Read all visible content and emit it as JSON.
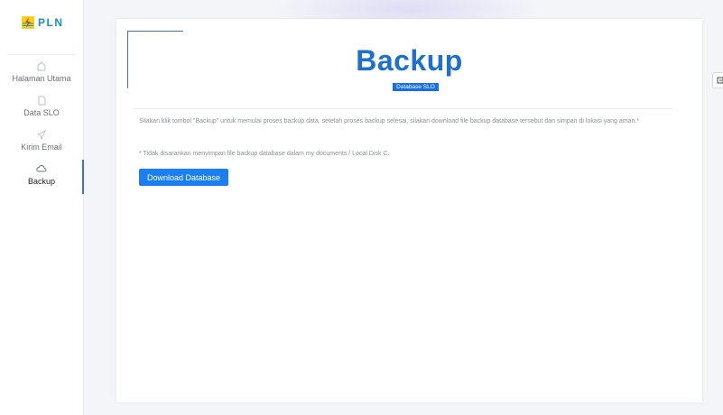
{
  "brand": {
    "name": "PLN"
  },
  "nav": {
    "items": [
      {
        "label": "Halaman Utama",
        "icon": "home-icon"
      },
      {
        "label": "Data SLO",
        "icon": "document-icon"
      },
      {
        "label": "Kirim Email",
        "icon": "send-icon"
      },
      {
        "label": "Backup",
        "icon": "cloud-icon",
        "active": true
      }
    ]
  },
  "page": {
    "title": "Backup",
    "subtitle": "Database SLO",
    "description": "Silakan klik tombol \"Backup\" untuk memulai proses backup data, setelah proses backup selesai, silakan download file backup database tersebut dan simpan di lokasi yang aman.*",
    "note": "* Tidak disarankan menyimpan file backup database dalam my documents / Local Disk C.",
    "button_label": "Download Database"
  },
  "colors": {
    "accent": "#1a7ff0",
    "title": "#1d6fd1",
    "brand_yellow": "#f7d116",
    "brand_blue": "#1a8ed1"
  }
}
